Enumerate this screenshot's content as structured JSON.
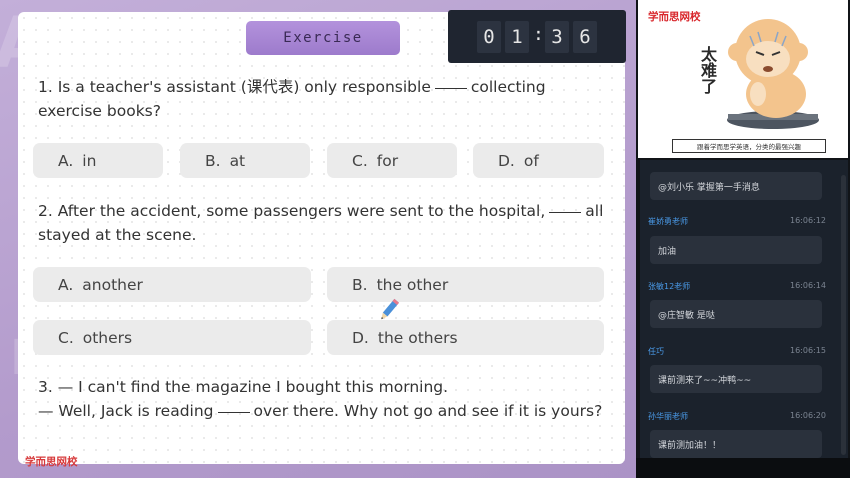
{
  "exercise_tab": "Exercise",
  "timer": {
    "d1": "0",
    "d2": "1",
    "colon": ":",
    "d3": "3",
    "d4": "6"
  },
  "questions": [
    {
      "before": "1. Is a teacher's assistant (课代表) only responsible",
      "after": "collecting",
      "line2": "exercise books?",
      "options": [
        {
          "letter": "A.",
          "text": "in"
        },
        {
          "letter": "B.",
          "text": "at"
        },
        {
          "letter": "C.",
          "text": "for"
        },
        {
          "letter": "D.",
          "text": "of"
        }
      ]
    },
    {
      "before": "2. After the accident, some passengers were sent to the hospital,",
      "after": "all",
      "line2": "stayed at the scene.",
      "options": [
        {
          "letter": "A.",
          "text": "another"
        },
        {
          "letter": "B.",
          "text": "the other"
        },
        {
          "letter": "C.",
          "text": "others"
        },
        {
          "letter": "D.",
          "text": "the others"
        }
      ]
    },
    {
      "line1": "3. — I can't find the magazine I bought this morning.",
      "before": "— Well, Jack is reading",
      "after": "over there. Why not go and see if it is yours?"
    }
  ],
  "watermark": "学而思网校",
  "sticker": {
    "brand": "学而思网校",
    "text": "太难了",
    "caption": "跟着学而思学英语，分类的最强兴趣"
  },
  "chat": [
    {
      "name": "",
      "time": "",
      "message": "@刘小乐 掌握第一手消息"
    },
    {
      "name": "崔娇勇老师",
      "time": "16:06:12",
      "message": "加油"
    },
    {
      "name": "张敏12老师",
      "time": "16:06:14",
      "message": "@庄智敏 是哒"
    },
    {
      "name": "任巧",
      "time": "16:06:15",
      "message": "课前测来了~~冲鸭~~"
    },
    {
      "name": "孙华丽老师",
      "time": "16:06:20",
      "message": "课前测加油！！"
    }
  ],
  "colors": {
    "accent": "#9d7bcc",
    "brand_red": "#d8262b",
    "chat_name": "#4a9ae8"
  }
}
